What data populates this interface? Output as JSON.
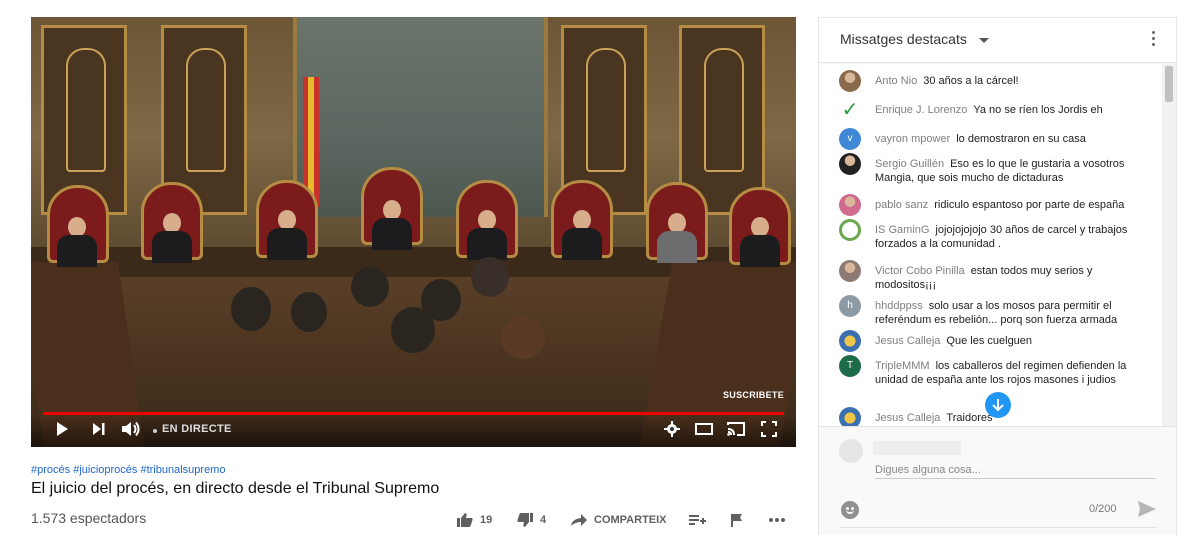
{
  "player": {
    "watermark": "SUSCRIBETE",
    "live_label": "EN DIRECTE",
    "progress_fraction": 1.0
  },
  "video": {
    "hashtags": [
      "#procés",
      "#juicioprocés",
      "#tribunalsupremo"
    ],
    "title": "El juicio del procés, en directo desde el Tribunal Supremo",
    "viewers": "1.573 espectadors",
    "likes": "19",
    "dislikes": "4",
    "share_label": "COMPARTEIX"
  },
  "chat": {
    "title": "Missatges destacats",
    "messages": [
      {
        "author": "Anto Nio",
        "text": "30 años a la cárcel!",
        "avatar": {
          "letter": "",
          "color": "#8a6a4a",
          "icon": "photo-avatar"
        }
      },
      {
        "author": "Enrique J. Lorenzo",
        "text": "Ya no se ríen los Jordis eh",
        "avatar": {
          "letter": "✓",
          "color": "#ffffff",
          "icon": "check-avatar"
        }
      },
      {
        "author": "vayron mpower",
        "text": "lo demostraron en su casa",
        "avatar": {
          "letter": "v",
          "color": "#3f88d6",
          "icon": "letter-avatar"
        }
      },
      {
        "author": "Sergio Guillén",
        "text": "Eso es lo que le gustaria a vosotros Mangia, que sois mucho de dictaduras",
        "avatar": {
          "letter": "",
          "color": "#222222",
          "icon": "photo-avatar"
        }
      },
      {
        "author": "pablo sanz",
        "text": "ridiculo espantoso por parte de españa",
        "avatar": {
          "letter": "",
          "color": "#d16a8e",
          "icon": "photo-avatar"
        }
      },
      {
        "author": "IS GaminG",
        "text": "jojojojojojo 30 años de carcel y trabajos forzados a la comunidad .",
        "avatar": {
          "letter": "",
          "color": "#6aa84f",
          "icon": "xbox-avatar"
        }
      },
      {
        "author": "Victor Cobo Pinilla",
        "text": "estan todos muy serios y modositos¡¡¡",
        "avatar": {
          "letter": "",
          "color": "#8c7a72",
          "icon": "photo-avatar"
        }
      },
      {
        "author": "hhddppss",
        "text": "solo usar a los mosos para permitir el referéndum es rebelión... porq son fuerza armada",
        "avatar": {
          "letter": "h",
          "color": "#8c9aa6",
          "icon": "letter-avatar"
        }
      },
      {
        "author": "Jesus Calleja",
        "text": "Que les cuelguen",
        "avatar": {
          "letter": "",
          "color": "#3a6fb0",
          "icon": "badge-avatar"
        }
      },
      {
        "author": "TripleMMM",
        "text": "los caballeros del regimen defienden la unidad de españa ante los rojos masones i judios",
        "avatar": {
          "letter": "T",
          "color": "#1e6b4a",
          "icon": "letter-avatar"
        }
      },
      {
        "author": "Jesus Calleja",
        "text": "Traidores",
        "avatar": {
          "letter": "",
          "color": "#3a6fb0",
          "icon": "badge-avatar"
        }
      }
    ],
    "composer": {
      "placeholder": "Digues alguna cosa...",
      "counter": "0/200"
    }
  },
  "colors": {
    "progress": "#ee0000",
    "hashtag": "#2068c8",
    "scroll_button": "#2196f3"
  }
}
